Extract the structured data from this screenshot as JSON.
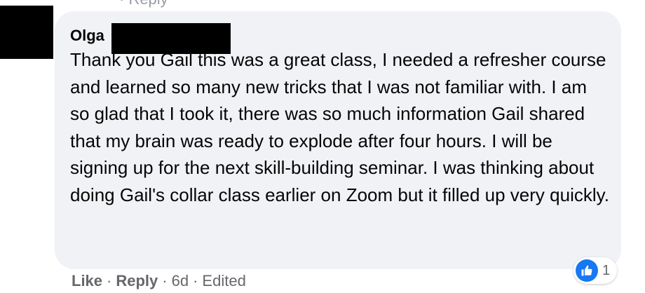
{
  "top_partial_text": "· Reply",
  "comment": {
    "author": "Olga",
    "text": "Thank you Gail this was a great class, I needed a refresher course and learned so many new tricks that I was not familiar with. I am so glad that I took it, there was so much information Gail shared that my brain was ready to explode after four hours. I will be signing up for the next skill-building seminar. I was thinking about doing Gail's collar class earlier on Zoom but it filled up very quickly."
  },
  "actions": {
    "like_label": "Like",
    "reply_label": "Reply",
    "separator": "·",
    "timestamp": "6d",
    "edited_label": "Edited"
  },
  "reactions": {
    "icon": "thumbs-up-icon",
    "count": "1",
    "color": "#1877f2"
  },
  "colors": {
    "bubble": "#f0f2f5",
    "text": "#050505",
    "secondary_text": "#65676b"
  }
}
